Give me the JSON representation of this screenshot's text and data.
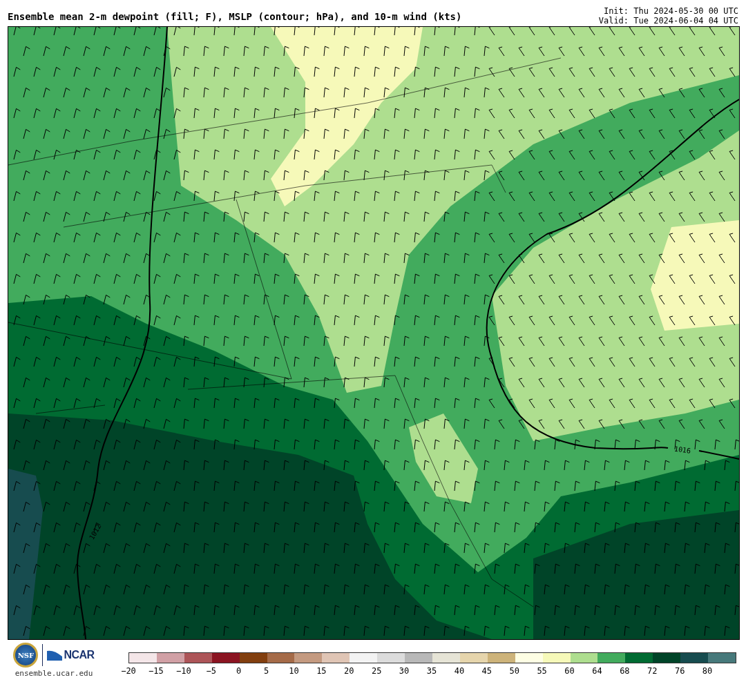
{
  "header": {
    "title": "Ensemble mean 2-m dewpoint (fill; F), MSLP (contour; hPa), and 10-m wind (kts)",
    "init": "Init: Thu 2024-05-30 00 UTC",
    "valid": "Valid: Tue 2024-06-04 04 UTC"
  },
  "map": {
    "contour_labels": [
      "1016",
      "1012"
    ]
  },
  "footer": {
    "nsf_logo": "NSF",
    "ncar_logo": "NCAR",
    "site": "ensemble.ucar.edu"
  },
  "colorbar": {
    "segments": [
      {
        "color": "#f4e6e8"
      },
      {
        "color": "#d1a0a5"
      },
      {
        "color": "#ad5558"
      },
      {
        "color": "#8b1421"
      },
      {
        "color": "#823f0f"
      },
      {
        "color": "#a56b48"
      },
      {
        "color": "#c49a80"
      },
      {
        "color": "#e0c5b5"
      },
      {
        "color": "#f3f3f3"
      },
      {
        "color": "#dcdcdc"
      },
      {
        "color": "#b8b8b8"
      },
      {
        "color": "#e6e4d6"
      },
      {
        "color": "#e6d5ac"
      },
      {
        "color": "#cdb37a"
      },
      {
        "color": "#fefee4"
      },
      {
        "color": "#f6f9b9"
      },
      {
        "color": "#aede8f"
      },
      {
        "color": "#42ab5d"
      },
      {
        "color": "#006b32"
      },
      {
        "color": "#004428"
      },
      {
        "color": "#174c4f"
      },
      {
        "color": "#47797b"
      }
    ],
    "ticks": [
      "−20",
      "−15",
      "−10",
      "−5",
      "0",
      "5",
      "10",
      "15",
      "20",
      "25",
      "30",
      "35",
      "40",
      "45",
      "50",
      "55",
      "60",
      "64",
      "68",
      "72",
      "76",
      "80"
    ]
  }
}
